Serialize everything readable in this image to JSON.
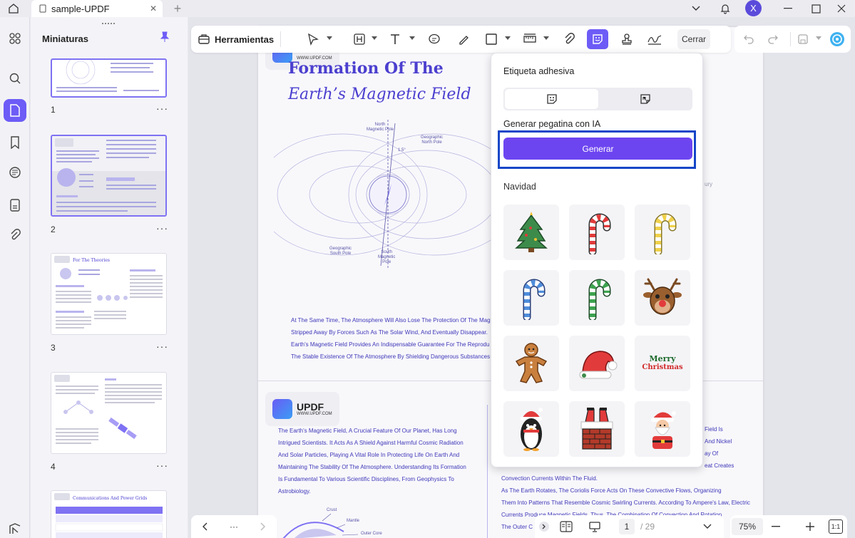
{
  "titlebar": {
    "tab_title": "sample-UPDF",
    "avatar_initial": "X"
  },
  "sidebar": {
    "panel_title": "Miniaturas",
    "thumbnails": [
      {
        "number": "1",
        "more": "···"
      },
      {
        "number": "2",
        "more": "···"
      },
      {
        "number": "3",
        "more": "···",
        "heading": "For The Theories"
      },
      {
        "number": "4",
        "more": "···"
      },
      {
        "heading": "Communications And Power Grids"
      }
    ]
  },
  "toolbar": {
    "tools_label": "Herramientas",
    "close_label": "Cerrar"
  },
  "document": {
    "logo_text": "UPDF",
    "logo_url": "WWW.UPDF.COM",
    "title_line1": "Formation Of The",
    "title_line2": "Earth’s Magnetic Field",
    "diagram": {
      "north_magnetic": "North\nMagnetic Pole",
      "geographic_north": "Geographic\nNorth Pole",
      "geographic_south": "Geographic\nSouth Pole",
      "south_magnetic": "South\nMagnetic\nPole",
      "angle": "1.5°"
    },
    "paragraph1": [
      "At The Same Time, The Atmosphere Will Also Lose The Protection Of The Mag",
      "Stripped Away By Forces Such As The Solar Wind, And Eventually Disappear.",
      "Earth's Magnetic Field Provides An Indispensable Guarantee For The Reprodu",
      "The Stable Existence Of The Atmosphere By Shielding Dangerous Substances"
    ],
    "paragraph2": [
      "The Earth's Magnetic Field, A Crucial Feature Of Our Planet, Has Long",
      "Intrigued Scientists. It Acts As A Shield Against Harmful Cosmic Radiation",
      "And Solar Particles, Playing A Vital Role In Protecting Life On Earth And",
      "Maintaining The Stability Of The Atmosphere. Understanding Its Formation",
      "Is Fundamental To Various Scientific Disciplines, From Geophysics To",
      "Astrobiology."
    ],
    "right_col": [
      "Convection Currents Within The Fluid.",
      "As The Earth Rotates, The Coriolis Force Acts On These Convective Flows, Organizing",
      "Them Into Patterns That Resemble Cosmic Swirling Currents. According To Ampere's Law, Electric",
      "Currents Produce Magnetic Fields. Thus, The Combination Of Convection And Rotation",
      "The Outer C"
    ],
    "right_peek": [
      "Field Is",
      "And Nickel",
      "ay Of",
      "eat Creates",
      "ury"
    ],
    "crust_labels": [
      "Crust",
      "Mantle",
      "Outer Core"
    ]
  },
  "sticker_panel": {
    "title": "Etiqueta adhesiva",
    "ai_label": "Generar pegatina con IA",
    "generate_button": "Generar",
    "category": "Navidad",
    "stickers": [
      "christmas-tree",
      "candy-cane-red",
      "candy-cane-yellow",
      "candy-cane-blue",
      "candy-cane-green",
      "reindeer",
      "gingerbread-man",
      "santa-hat",
      "merry-christmas-text",
      "penguin-santa-hat",
      "santa-chimney",
      "santa-claus"
    ],
    "merry_text_1": "Merry",
    "merry_text_2": "Christmas"
  },
  "bottom": {
    "more": "···",
    "page_current": "1",
    "page_total": "/ 29",
    "zoom": "75%",
    "fit": "1:1"
  },
  "colors": {
    "accent": "#6d5cf6",
    "generate": "#6d45f0",
    "highlight_box": "#1546c8",
    "title_text": "#4b3fcf"
  }
}
